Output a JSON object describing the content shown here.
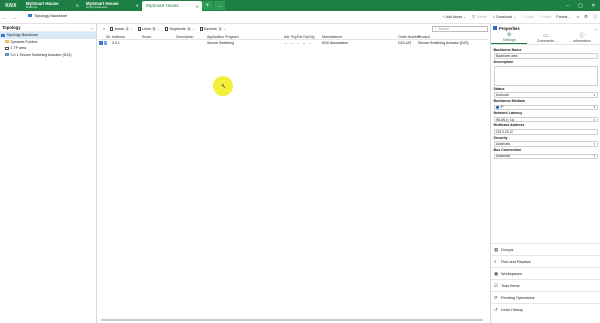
{
  "titlebar": {
    "logo": "KNX",
    "tabs": [
      {
        "title": "MySmart House",
        "subtitle": "Buildings"
      },
      {
        "title": "MySmart House",
        "subtitle": "Group Addresses"
      },
      {
        "title": "MySmart House",
        "subtitle": ""
      }
    ],
    "new_tab": "+",
    "tab_menu": "⌄",
    "window_controls": [
      "–",
      "▢",
      "✕"
    ]
  },
  "toolbar": {
    "add_areas": "Add Areas",
    "delete": "Delete",
    "download": "Download",
    "undo": "Undo",
    "redo": "Redo",
    "panels": "Panels"
  },
  "topology": {
    "title": "Topology",
    "items": [
      {
        "label": "Topology Backbone",
        "selected": true
      },
      {
        "label": "Dynamic Folders",
        "selected": false
      },
      {
        "label": "1 TP area",
        "selected": false
      },
      {
        "label": "0.0.1 Secure Switching Actuator (D23)",
        "selected": false
      }
    ]
  },
  "center": {
    "breadcrumb": "Topology Backbone",
    "filters": [
      {
        "label": "Areas",
        "count": "1"
      },
      {
        "label": "Lines",
        "count": "0"
      },
      {
        "label": "Segments",
        "count": "0"
      },
      {
        "label": "Devices",
        "count": "1"
      }
    ],
    "search_placeholder": "Search",
    "columns": [
      "Se",
      "Address",
      "Room",
      "Description",
      "Application Program",
      "Adr",
      "Prg",
      "Par",
      "Grp",
      "Cfg",
      "Manufacturer",
      "Order Number",
      "Product"
    ],
    "rows": [
      {
        "address": "0.0.1",
        "room": "",
        "description": "",
        "application": "Secure Switching",
        "adr": "–",
        "prg": "–",
        "par": "–",
        "grp": "–",
        "cfg": "–",
        "manufacturer": "KNX Association",
        "order": "D23-v23",
        "product": "Secure Switching Actuator (D23)"
      }
    ]
  },
  "properties": {
    "title": "Properties",
    "tabs": [
      {
        "label": "Settings",
        "icon": "gear-icon"
      },
      {
        "label": "Comments",
        "icon": "comment-icon"
      },
      {
        "label": "Information",
        "icon": "info-icon"
      }
    ],
    "fields": {
      "backbone_name_label": "Backbone Name",
      "backbone_name_value": "Backbone area",
      "description_label": "Description",
      "status_label": "Status",
      "status_value": "Unknown",
      "medium_label": "Backbone Medium",
      "medium_value": "IP",
      "latency_label": "Network Latency",
      "latency_value": "WLAN (< 1s)",
      "multicast_label": "Multicast Address",
      "multicast_value": "224.0.23.12",
      "security_label": "Security",
      "security_value": "Automatic",
      "bus_label": "Bus Connection",
      "bus_value": "Automatic"
    },
    "panels": [
      {
        "label": "Groups",
        "icon": "groups-icon"
      },
      {
        "label": "Find and Replace",
        "icon": "search-icon"
      },
      {
        "label": "Workspaces",
        "icon": "workspaces-icon"
      },
      {
        "label": "Todo Items",
        "icon": "todo-icon"
      },
      {
        "label": "Pending Operations",
        "icon": "pending-icon"
      },
      {
        "label": "Undo History",
        "icon": "history-icon"
      }
    ]
  }
}
